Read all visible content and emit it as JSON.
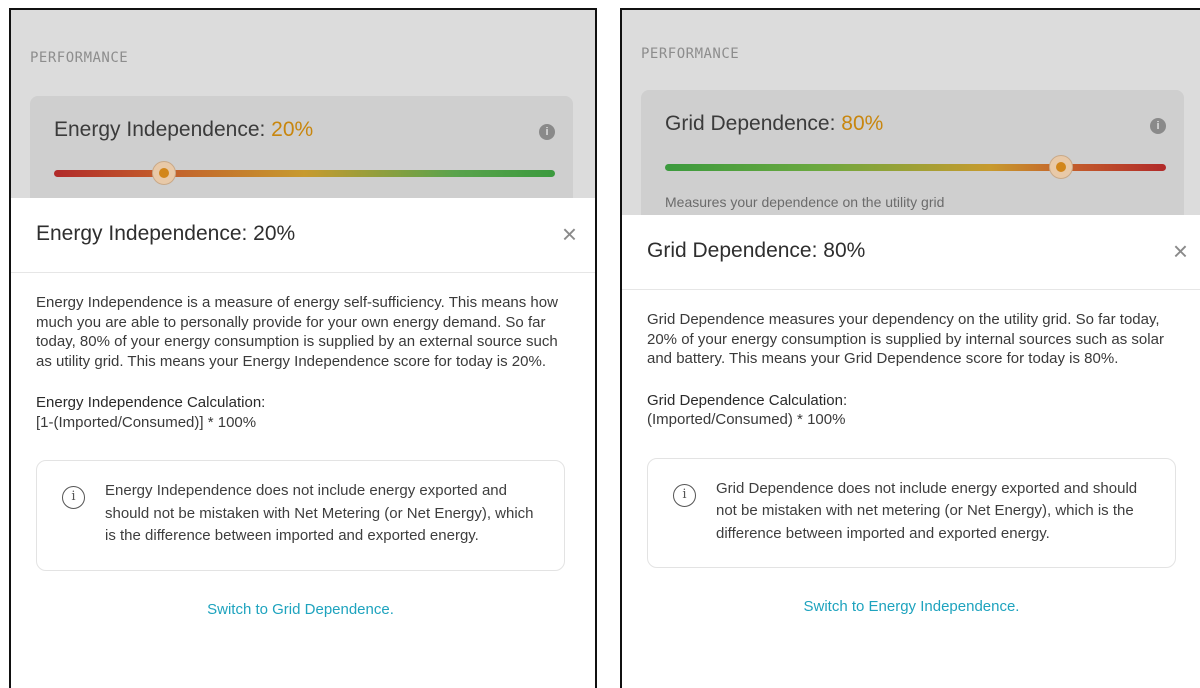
{
  "left": {
    "performance_label": "PERFORMANCE",
    "metric": {
      "name": "Energy Independence: ",
      "percent": "20%",
      "level": 0.22
    },
    "modal": {
      "title": "Energy Independence: 20%",
      "close_icon": "×",
      "description": "Energy Independence is a measure of energy self-sufficiency. This means how much you are able to personally provide for your own energy demand. So far today, 80% of your energy consumption is supplied by an external source such as utility grid. This means your Energy Independence score for today is 20%.",
      "calc_title": "Energy Independence Calculation:",
      "calc_formula": "[1-(Imported/Consumed)] * 100%",
      "note_icon": "i",
      "note": "Energy Independence does not include energy exported and should not be mistaken with Net Metering (or Net Energy), which is the difference between imported and exported energy.",
      "switch_link": "Switch to Grid Dependence."
    }
  },
  "right": {
    "performance_label": "PERFORMANCE",
    "metric": {
      "name": "Grid Dependence: ",
      "percent": "80%",
      "level": 0.79,
      "caption": "Measures your dependence on the utility grid"
    },
    "modal": {
      "title": "Grid Dependence: 80%",
      "close_icon": "×",
      "description": "Grid Dependence measures your dependency on the utility grid. So far today, 20% of your energy consumption is supplied by internal sources such as solar and battery. This means your Grid Dependence score for today is 80%.",
      "calc_title": "Grid Dependence Calculation:",
      "calc_formula": "(Imported/Consumed) * 100%",
      "note_icon": "i",
      "note": "Grid Dependence does not include energy exported and should not be mistaken with net metering (or Net Energy), which is the difference between imported and exported energy.",
      "switch_link": "Switch to Energy Independence."
    }
  },
  "colors": {
    "accent_percent": "#c8860e",
    "link": "#1ea3be",
    "overlay": "#dcdcdc"
  },
  "icons": {
    "info": "info-icon",
    "close": "close-icon",
    "note": "info-circle-icon"
  }
}
